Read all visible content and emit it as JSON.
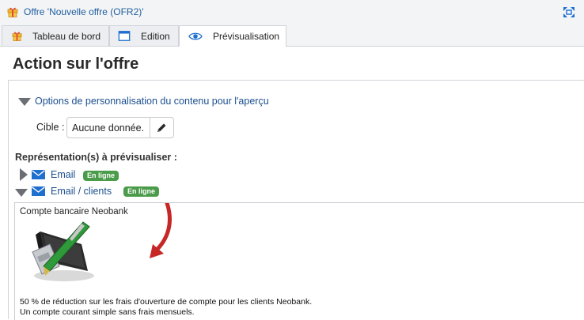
{
  "window": {
    "title": "Offre 'Nouvelle offre (OFR2)'"
  },
  "tabs": [
    {
      "label": "Tableau de bord",
      "icon": "gift-icon"
    },
    {
      "label": "Edition",
      "icon": "window-icon"
    },
    {
      "label": "Prévisualisation",
      "icon": "eye-icon",
      "active": true
    }
  ],
  "page": {
    "heading": "Action sur l'offre"
  },
  "options": {
    "label": "Options de personnalisation du contenu pour l'aperçu"
  },
  "cible": {
    "label": "Cible :",
    "value": "Aucune donnée."
  },
  "representations": {
    "label": "Représentation(s) à prévisualiser :",
    "items": [
      {
        "label": "Email",
        "badge": "En ligne",
        "expanded": false
      },
      {
        "label": "Email / clients",
        "badge": "En ligne",
        "expanded": true
      }
    ]
  },
  "preview": {
    "account_title": "Compte bancaire Neobank",
    "line1": "50 % de réduction sur les frais d'ouverture de compte pour les clients Neobank.",
    "line2": "Un compte courant simple sans frais mensuels."
  },
  "colors": {
    "link": "#1c4f8f",
    "badge": "#4a9b4a",
    "arrow": "#c62828",
    "accent": "#1f6fcf"
  }
}
